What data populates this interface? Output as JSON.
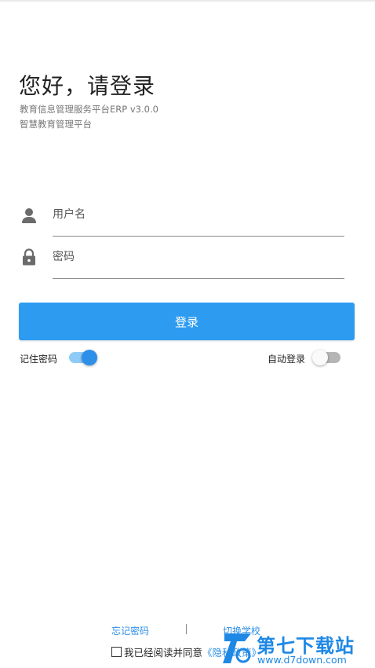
{
  "header": {
    "greeting": "您好，请登录",
    "subtitle_line1": "教育信息管理服务平台ERP v3.0.0",
    "subtitle_line2": "智慧教育管理平台"
  },
  "form": {
    "username_placeholder": "用户名",
    "username_value": "",
    "password_placeholder": "密码",
    "password_value": "",
    "login_label": "登录"
  },
  "options": {
    "remember_label": "记住密码",
    "remember_on": true,
    "autologin_label": "自动登录",
    "autologin_on": false
  },
  "footer": {
    "forgot_label": "忘记密码",
    "switch_school_label": "切换学校",
    "agree_prefix": "我已经阅读并同意",
    "privacy_link": "《隐私政策》"
  },
  "watermark": {
    "brand": "第七下载站",
    "url": "www.d7down.com"
  },
  "colors": {
    "primary": "#2d9cf0",
    "link": "#2d8fe8"
  },
  "icons": [
    "user-icon",
    "lock-icon",
    "watermark-logo-icon"
  ]
}
